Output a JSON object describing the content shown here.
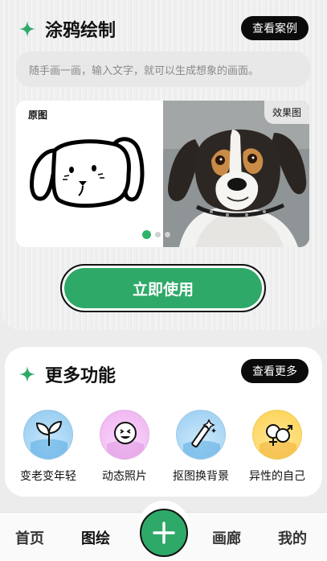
{
  "doodle": {
    "title": "涂鸦绘制",
    "cases_button": "查看案例",
    "prompt_placeholder": "随手画一画，输入文字，就可以生成想象的画面。",
    "original_tag": "原图",
    "effect_tag": "效果图",
    "carousel": {
      "count": 3,
      "active": 0
    },
    "use_button": "立即使用"
  },
  "more": {
    "title": "更多功能",
    "more_button": "查看更多",
    "features": [
      {
        "label": "变老变年轻",
        "icon": "sprout-icon",
        "color": "#9fd3f3"
      },
      {
        "label": "动态照片",
        "icon": "smiley-icon",
        "color": "#f0b8f2"
      },
      {
        "label": "抠图换背景",
        "icon": "magic-wand-icon",
        "color": "#a9d7f5"
      },
      {
        "label": "异性的自己",
        "icon": "gender-icon",
        "color": "#ffd95a"
      }
    ]
  },
  "nav": {
    "home": "首页",
    "draw": "图绘",
    "gallery": "画廊",
    "mine": "我的"
  },
  "colors": {
    "accent": "#2fa968",
    "dark": "#0b0b0b"
  }
}
